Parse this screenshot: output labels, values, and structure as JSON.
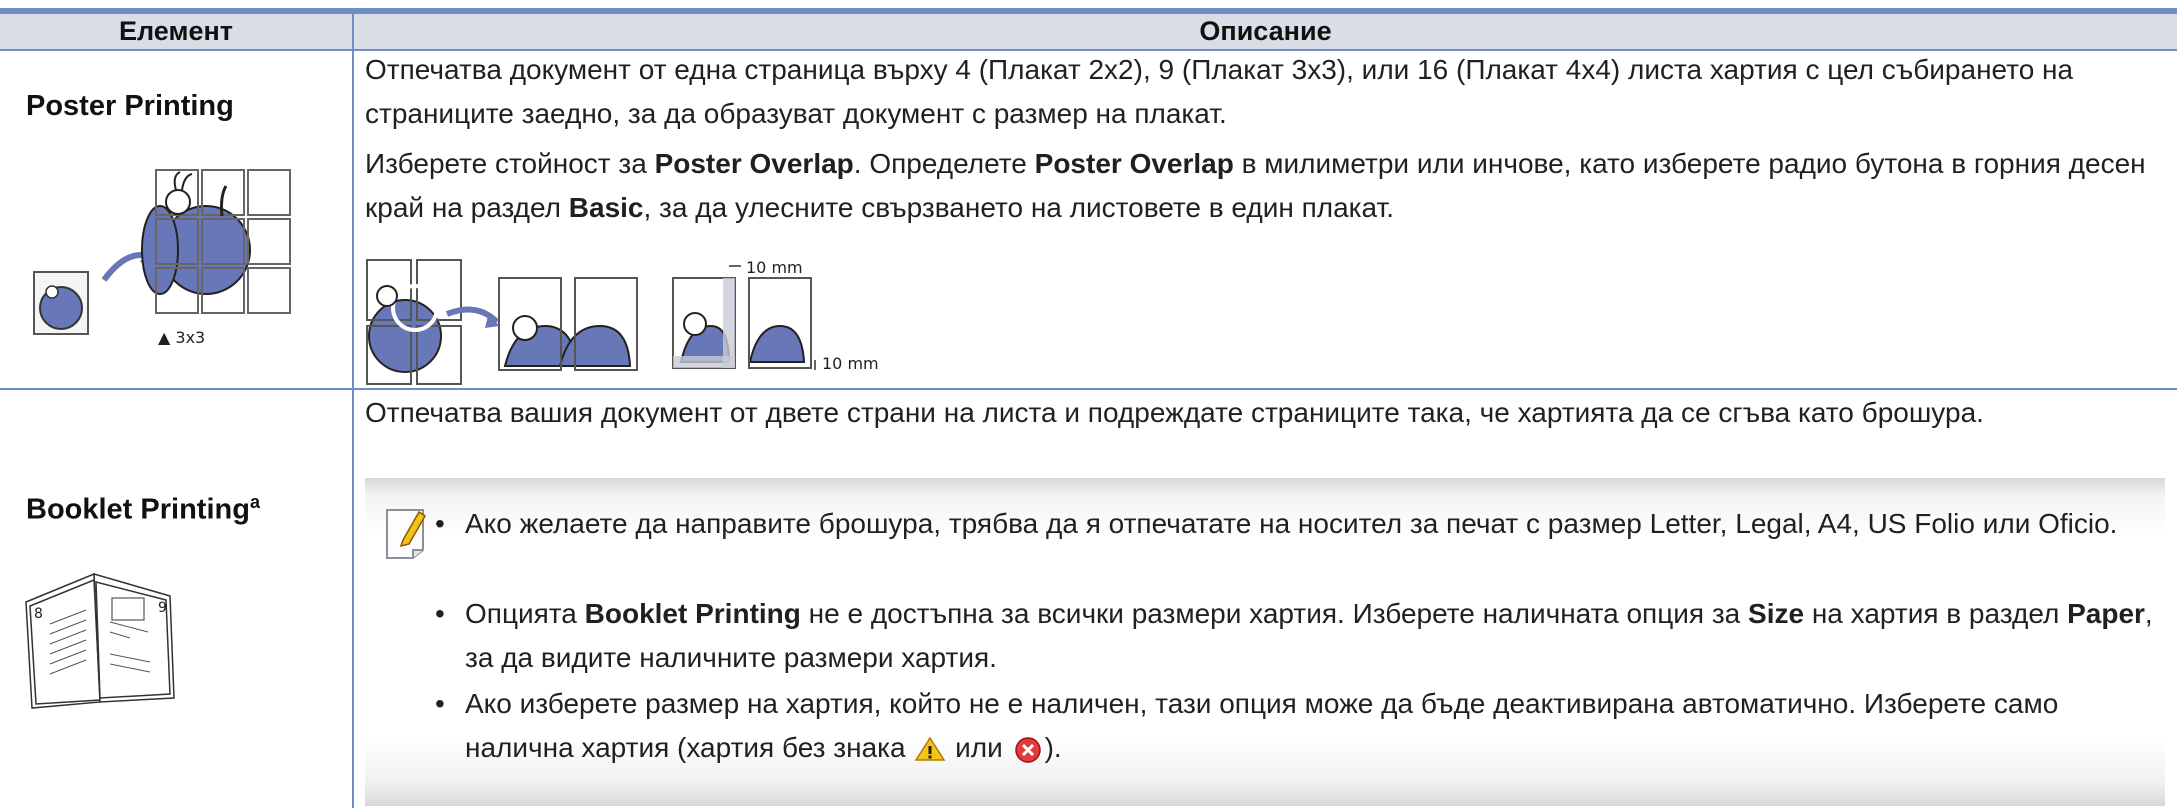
{
  "header": {
    "col_element": "Елемент",
    "col_description": "Описание"
  },
  "rows": [
    {
      "name": "Poster Printing",
      "p1": "Отпечатва документ от една страница върху 4 (Плакат 2x2), 9 (Плакат 3x3), или 16 (Плакат 4x4) листа хартия с цел събирането на страниците заедно, за да образуват документ с размер на плакат.",
      "p2_a": "Изберете стойност за ",
      "p2_b": "Poster Overlap",
      "p2_c": ". Определете ",
      "p2_d": "Poster Overlap",
      "p2_e": " в милиметри или инчове, като изберете радио бутона в горния десен край на раздел ",
      "p2_f": "Basic",
      "p2_g": ", за да улесните свързването на листовете в един плакат.",
      "image_caption": "▲ 3x3",
      "dim_top": "10 mm",
      "dim_right": "10 mm"
    },
    {
      "name": "Booklet Printing",
      "name_sup": "a",
      "p1": "Отпечатва вашия документ от двете страни на листа и подреждате страниците така, че хартията да се сгъва като брошура.",
      "page_left": "8",
      "page_right": "9",
      "bullets": [
        {
          "a": "Ако желаете да направите брошура, трябва да я отпечатате на носител за печат с размер Letter, Legal, A4, US Folio или Oficio."
        },
        {
          "a": "Опцията ",
          "b": "Booklet Printing",
          "c": " не е достъпна за всички размери хартия. Изберете наличната опция за ",
          "d": "Size",
          "e": " на хартия в раздел ",
          "f": "Paper",
          "g": ", за да видите наличните размери хартия."
        },
        {
          "a": "Ако изберете размер на хартия, който не е наличен, тази опция може да бъде деактивирана автоматично. Изберете само налична хартия (хартия без знака ",
          "b": " или ",
          "c": ")."
        }
      ]
    }
  ],
  "icons": {
    "note": "note-pencil-icon",
    "warning": "warning-triangle-icon",
    "error": "error-x-icon"
  },
  "colors": {
    "rule": "#6e8fc6",
    "header_bg": "#d9dde5",
    "apple": "#6877b8"
  }
}
